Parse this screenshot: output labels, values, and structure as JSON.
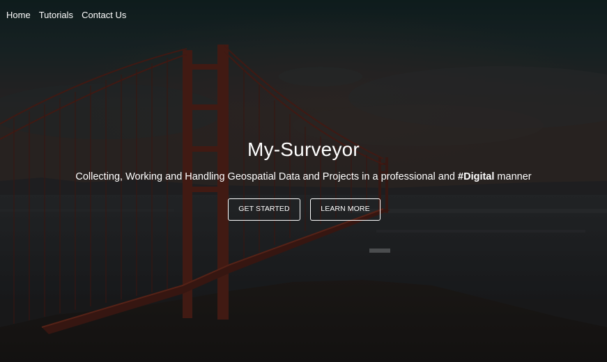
{
  "nav": {
    "items": [
      {
        "label": "Home"
      },
      {
        "label": "Tutorials"
      },
      {
        "label": "Contact Us"
      }
    ]
  },
  "hero": {
    "title": "My-Surveyor",
    "subtitle_main": "Collecting, Working and Handling Geospatial Data and Projects in a professional and ",
    "subtitle_highlight": "#Digital",
    "subtitle_end": " manner",
    "background_image": "golden-gate-bridge-dusk",
    "buttons": {
      "get_started": "GET STARTED",
      "learn_more": "LEARN MORE"
    }
  },
  "colors": {
    "text": "#ffffff",
    "overlay": "#1d1d1e",
    "sky_teal": "#0f2c2d",
    "bridge": "#6b2316"
  }
}
